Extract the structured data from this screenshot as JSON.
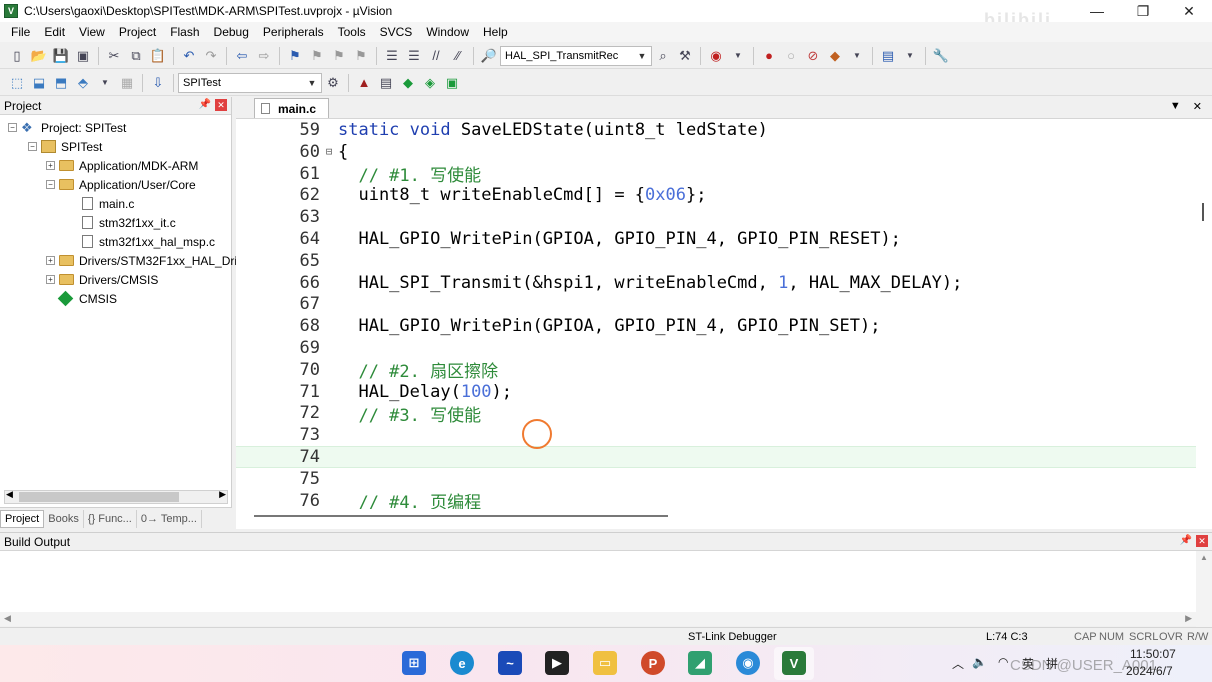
{
  "window": {
    "title": "C:\\Users\\gaoxi\\Desktop\\SPITest\\MDK-ARM\\SPITest.uvprojx - µVision",
    "app_icon_text": "V",
    "controls": [
      "—",
      "❐",
      "✕"
    ],
    "watermark": "bilibili"
  },
  "menu": [
    "File",
    "Edit",
    "View",
    "Project",
    "Flash",
    "Debug",
    "Peripherals",
    "Tools",
    "SVCS",
    "Window",
    "Help"
  ],
  "toolbar1": {
    "find_combo_value": "HAL_SPI_TransmitRec"
  },
  "toolbar2": {
    "target_combo_value": "SPITest"
  },
  "project_panel": {
    "title": "Project",
    "tree": [
      {
        "label": "Project: SPITest",
        "expander": "−"
      },
      {
        "label": "SPITest",
        "expander": "−"
      },
      {
        "label": "Application/MDK-ARM",
        "expander": "+"
      },
      {
        "label": "Application/User/Core",
        "expander": "−"
      },
      {
        "label": "main.c"
      },
      {
        "label": "stm32f1xx_it.c"
      },
      {
        "label": "stm32f1xx_hal_msp.c"
      },
      {
        "label": "Drivers/STM32F1xx_HAL_Driv",
        "expander": "+"
      },
      {
        "label": "Drivers/CMSIS",
        "expander": "+"
      },
      {
        "label": "CMSIS"
      }
    ],
    "tabs": [
      "Project",
      "Books",
      "{} Func...",
      "0→ Temp..."
    ]
  },
  "editor": {
    "active_tab": "main.c",
    "lines": [
      {
        "n": "59",
        "fold": "",
        "tokens": [
          {
            "t": "static void",
            "c": "kw"
          },
          {
            "t": " SaveLEDState(uint8_t ledState)",
            "c": ""
          }
        ]
      },
      {
        "n": "60",
        "fold": "⊟",
        "tokens": [
          {
            "t": "{",
            "c": ""
          }
        ]
      },
      {
        "n": "61",
        "fold": "",
        "tokens": [
          {
            "t": "  // #1. 写使能",
            "c": "cm"
          }
        ]
      },
      {
        "n": "62",
        "fold": "",
        "tokens": [
          {
            "t": "  uint8_t writeEnableCmd[] = {",
            "c": ""
          },
          {
            "t": "0x06",
            "c": "num"
          },
          {
            "t": "};",
            "c": ""
          }
        ]
      },
      {
        "n": "63",
        "fold": "",
        "tokens": []
      },
      {
        "n": "64",
        "fold": "",
        "tokens": [
          {
            "t": "  HAL_GPIO_WritePin(GPIOA, GPIO_PIN_4, GPIO_PIN_RESET);",
            "c": ""
          }
        ]
      },
      {
        "n": "65",
        "fold": "",
        "tokens": []
      },
      {
        "n": "66",
        "fold": "",
        "tokens": [
          {
            "t": "  HAL_SPI_Transmit(&hspi1, writeEnableCmd, ",
            "c": ""
          },
          {
            "t": "1",
            "c": "num"
          },
          {
            "t": ", HAL_MAX_DELAY);",
            "c": ""
          }
        ]
      },
      {
        "n": "67",
        "fold": "",
        "tokens": []
      },
      {
        "n": "68",
        "fold": "",
        "tokens": [
          {
            "t": "  HAL_GPIO_WritePin(GPIOA, GPIO_PIN_4, GPIO_PIN_SET);",
            "c": ""
          }
        ]
      },
      {
        "n": "69",
        "fold": "",
        "tokens": []
      },
      {
        "n": "70",
        "fold": "",
        "tokens": [
          {
            "t": "  // #2. 扇区擦除",
            "c": "cm"
          }
        ]
      },
      {
        "n": "71",
        "fold": "",
        "tokens": [
          {
            "t": "  HAL_Delay(",
            "c": ""
          },
          {
            "t": "100",
            "c": "num"
          },
          {
            "t": ");",
            "c": ""
          }
        ]
      },
      {
        "n": "72",
        "fold": "",
        "tokens": [
          {
            "t": "  // #3. 写使能",
            "c": "cm"
          }
        ]
      },
      {
        "n": "73",
        "fold": "",
        "tokens": []
      },
      {
        "n": "74",
        "fold": "",
        "tokens": [],
        "current": true
      },
      {
        "n": "75",
        "fold": "",
        "tokens": []
      },
      {
        "n": "76",
        "fold": "",
        "tokens": [
          {
            "t": "  // #4. 页编程",
            "c": "cm"
          }
        ]
      }
    ]
  },
  "build_output": {
    "title": "Build Output"
  },
  "status": {
    "debugger": "ST-Link Debugger",
    "cursor_pos": "L:74 C:3",
    "indicators": [
      "CAP",
      "NUM",
      "SCRL",
      "OVR",
      "R/W"
    ]
  },
  "taskbar": {
    "ime": "英",
    "ime2": "拼",
    "time": "11:50:07",
    "date": "2024/6/7",
    "watermark": "CSDN @USER_A001"
  }
}
